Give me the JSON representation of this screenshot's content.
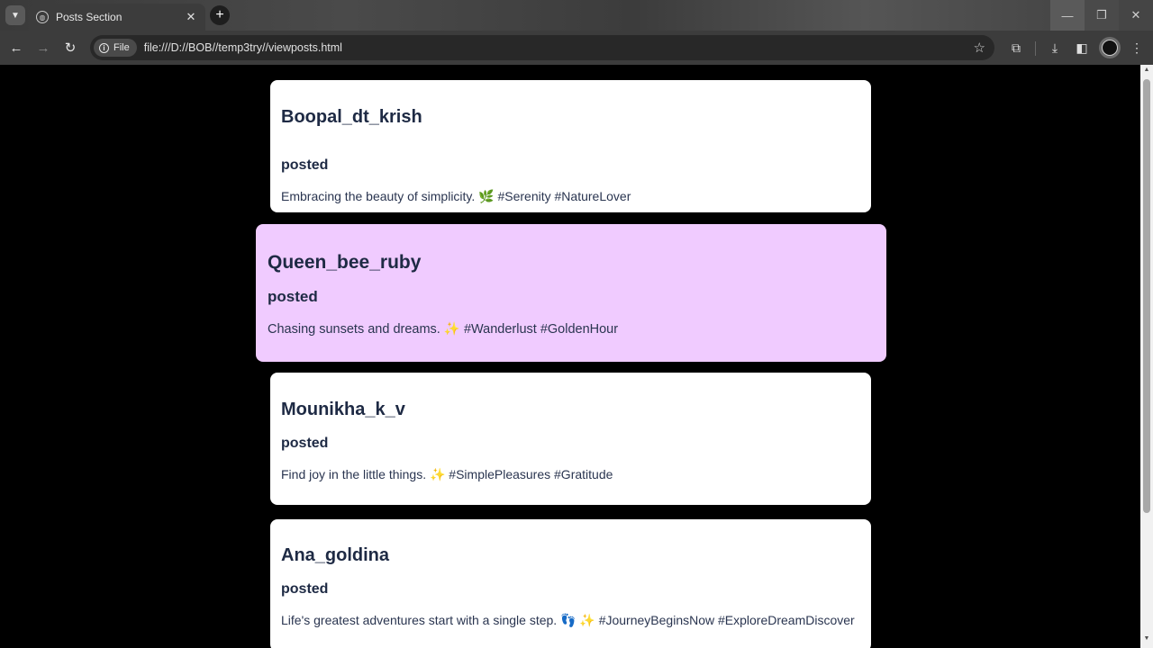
{
  "browser": {
    "tab_title": "Posts Section",
    "url_scheme_chip": "File",
    "url": "file:///D://BOB//temp3try//viewposts.html"
  },
  "posts": [
    {
      "author": "Boopal_dt_krish",
      "status": "posted",
      "caption": "Embracing the beauty of simplicity. 🌿 #Serenity #NatureLover"
    },
    {
      "author": "Queen_bee_ruby",
      "status": "posted",
      "caption": "Chasing sunsets and dreams. ✨ #Wanderlust #GoldenHour"
    },
    {
      "author": "Mounikha_k_v",
      "status": "posted",
      "caption": "Find joy in the little things. ✨ #SimplePleasures #Gratitude"
    },
    {
      "author": "Ana_goldina",
      "status": "posted",
      "caption": "Life's greatest adventures start with a single step. 👣 ✨ #JourneyBeginsNow #ExploreDreamDiscover"
    }
  ],
  "colors": {
    "card": "#ffffff",
    "card_hover": "#f0cbff",
    "text": "#1e2a44",
    "page_bg": "#000000"
  }
}
